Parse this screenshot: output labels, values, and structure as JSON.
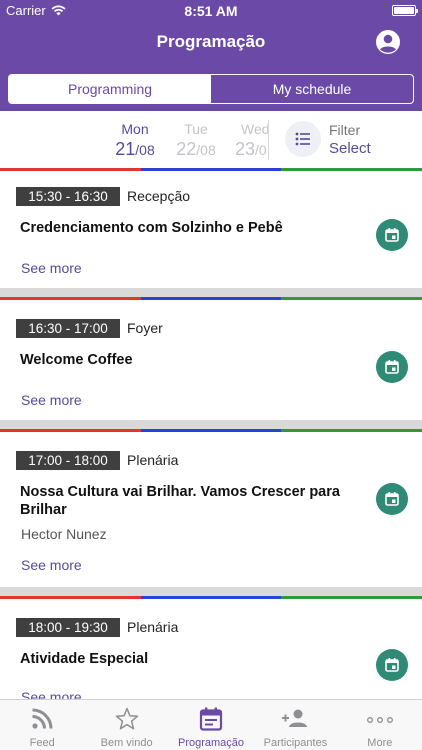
{
  "status": {
    "carrier": "Carrier",
    "time": "8:51 AM"
  },
  "header": {
    "title": "Programação"
  },
  "segment": {
    "programming": "Programming",
    "my_schedule": "My schedule"
  },
  "days": [
    {
      "dow": "Mon",
      "day": "21",
      "month": "/08",
      "state": "selected"
    },
    {
      "dow": "Tue",
      "day": "22",
      "month": "/08",
      "state": "muted"
    },
    {
      "dow": "Wed",
      "day": "23",
      "month": "/0",
      "state": "muted"
    }
  ],
  "filter": {
    "title": "Filter",
    "value": "Select"
  },
  "colors": {
    "accent": "#6a4aa6",
    "red": "#e0362b",
    "blue": "#2a43d6",
    "green": "#2e9a39",
    "calendar": "#2f8a76"
  },
  "events": [
    {
      "time": "15:30 - 16:30",
      "room": "Recepção",
      "title": "Credenciamento com Solzinho e Pebê",
      "speaker": "",
      "see_more": "See more"
    },
    {
      "time": "16:30 - 17:00",
      "room": "Foyer",
      "title": "Welcome Coffee",
      "speaker": "",
      "see_more": "See more"
    },
    {
      "time": "17:00 - 18:00",
      "room": "Plenária",
      "title": "Nossa Cultura vai Brilhar. Vamos Crescer para Brilhar",
      "speaker": "Hector Nunez",
      "see_more": "See more"
    },
    {
      "time": "18:00 - 19:30",
      "room": "Plenária",
      "title": "Atividade Especial",
      "speaker": "",
      "see_more": "See more"
    }
  ],
  "tabs": [
    {
      "label": "Feed",
      "icon": "rss-icon"
    },
    {
      "label": "Bem vindo",
      "icon": "star-icon"
    },
    {
      "label": "Programação",
      "icon": "calendar-icon"
    },
    {
      "label": "Participantes",
      "icon": "people-icon"
    },
    {
      "label": "More",
      "icon": "more-dots-icon"
    }
  ]
}
